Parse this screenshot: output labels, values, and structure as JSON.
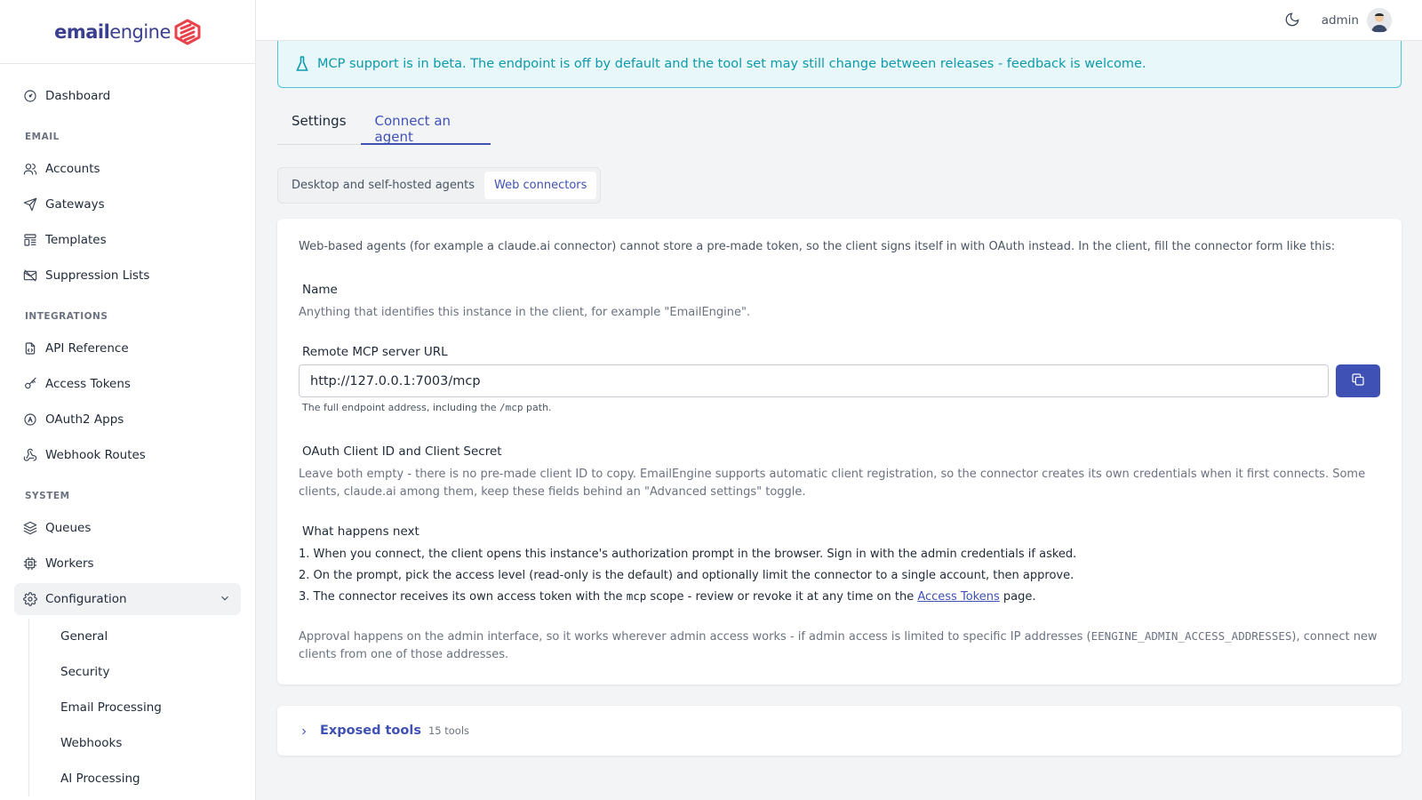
{
  "brand": {
    "bold": "email",
    "light": "engine"
  },
  "topbar": {
    "user": "admin"
  },
  "sidebar": {
    "dashboard": "Dashboard",
    "sections": {
      "email": "EMAIL",
      "integrations": "INTEGRATIONS",
      "system": "SYSTEM"
    },
    "email_items": [
      "Accounts",
      "Gateways",
      "Templates",
      "Suppression Lists"
    ],
    "integration_items": [
      "API Reference",
      "Access Tokens",
      "OAuth2 Apps",
      "Webhook Routes"
    ],
    "system_items": [
      "Queues",
      "Workers",
      "Configuration"
    ],
    "config_sub": [
      "General",
      "Security",
      "Email Processing",
      "Webhooks",
      "AI Processing"
    ]
  },
  "alert": {
    "text": "MCP support is in beta. The endpoint is off by default and the tool set may still change between releases - feedback is welcome."
  },
  "tabs": [
    "Settings",
    "Connect an agent"
  ],
  "pills": [
    "Desktop and self-hosted agents",
    "Web connectors"
  ],
  "card": {
    "intro": "Web-based agents (for example a claude.ai connector) cannot store a pre-made token, so the client signs itself in with OAuth instead. In the client, fill the connector form like this:",
    "name_label": "Name",
    "name_help": "Anything that identifies this instance in the client, for example \"EmailEngine\".",
    "url_label": "Remote MCP server URL",
    "url_value": "http://127.0.0.1:7003/mcp",
    "url_help_before": "The full endpoint address, including the",
    "url_help_code": "/mcp",
    "url_help_after": "path.",
    "oauth_label": "OAuth Client ID and Client Secret",
    "oauth_help": "Leave both empty - there is no pre-made client ID to copy. EmailEngine supports automatic client registration, so the connector creates its own credentials when it first connects. Some clients, claude.ai among them, keep these fields behind an \"Advanced settings\" toggle.",
    "next_label": "What happens next",
    "step1": "1. When you connect, the client opens this instance's authorization prompt in the browser. Sign in with the admin credentials if asked.",
    "step2": "2. On the prompt, pick the access level (read-only is the default) and optionally limit the connector to a single account, then approve.",
    "step3_before": "3. The connector receives its own access token with the",
    "step3_code": "mcp",
    "step3_mid": "scope - review or revoke it at any time on the",
    "step3_link": "Access Tokens",
    "step3_after": "page.",
    "approval_before": "Approval happens on the admin interface, so it works wherever admin access works - if admin access is limited to specific IP addresses (",
    "approval_code": "EENGINE_ADMIN_ACCESS_ADDRESSES",
    "approval_after": "), connect new clients from one of those addresses."
  },
  "tools": {
    "title": "Exposed tools",
    "count": "15 tools"
  },
  "colors": {
    "accent": "#3f51b5",
    "info": "#0e9aab",
    "brand": "#3a3f8f",
    "logo": "#e8424b"
  }
}
